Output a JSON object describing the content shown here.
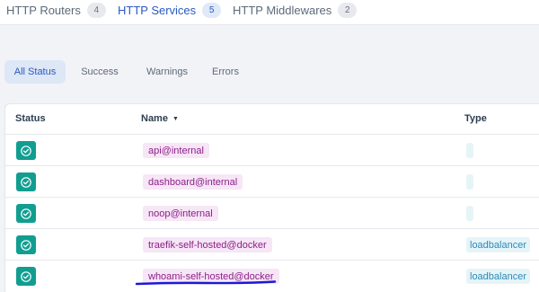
{
  "tabs": [
    {
      "label": "HTTP Routers",
      "count": "4",
      "active": false
    },
    {
      "label": "HTTP Services",
      "count": "5",
      "active": true
    },
    {
      "label": "HTTP Middlewares",
      "count": "2",
      "active": false
    }
  ],
  "filters": [
    {
      "label": "All Status",
      "active": true
    },
    {
      "label": "Success",
      "active": false
    },
    {
      "label": "Warnings",
      "active": false
    },
    {
      "label": "Errors",
      "active": false
    }
  ],
  "table": {
    "columns": {
      "status": "Status",
      "name": "Name",
      "type": "Type"
    },
    "sort_icon": "caret-down-icon",
    "rows": [
      {
        "status": "success",
        "name": "api@internal",
        "type": ""
      },
      {
        "status": "success",
        "name": "dashboard@internal",
        "type": ""
      },
      {
        "status": "success",
        "name": "noop@internal",
        "type": ""
      },
      {
        "status": "success",
        "name": "traefik-self-hosted@docker",
        "type": "loadbalancer"
      },
      {
        "status": "success",
        "name": "whoami-self-hosted@docker",
        "type": "loadbalancer"
      }
    ]
  },
  "colors": {
    "accent": "#2b59c3",
    "success": "#119e91",
    "name_tag_bg": "#f6e6f6",
    "name_tag_text": "#8e1e88",
    "type_tag_bg": "#e6f4f8",
    "type_tag_text": "#2a8bb7",
    "annotation_underline": "#1a1ad6"
  }
}
